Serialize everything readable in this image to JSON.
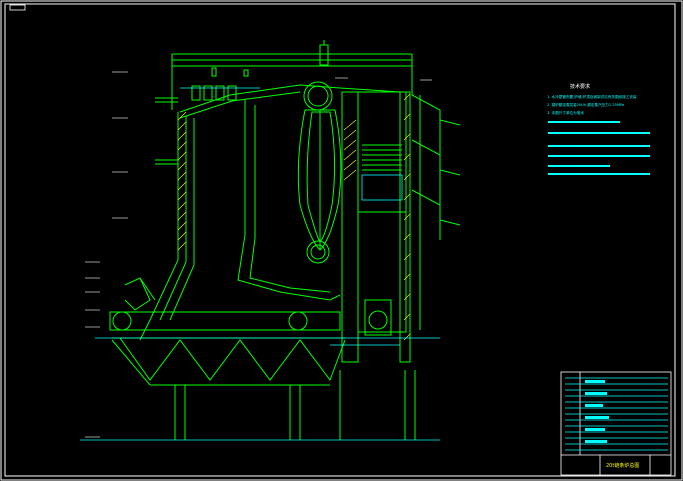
{
  "drawing": {
    "title_block_label": "20t链条炉总图",
    "notes_heading": "技术要求",
    "notes_line_1": "1. 水冷壁管布置,炉墙,炉顶及钢架详见有关图纸施工安装",
    "notes_line_2": "2. 锅炉额定蒸发量20t/h,额定蒸汽压力1.25MPa",
    "notes_line_3": "3. 本图尺寸单位为毫米",
    "colors": {
      "background": "#000000",
      "frame": "#ffffff",
      "structure": "#00ff00",
      "annotation": "#00ffff",
      "hatch": "#ffff00"
    }
  }
}
